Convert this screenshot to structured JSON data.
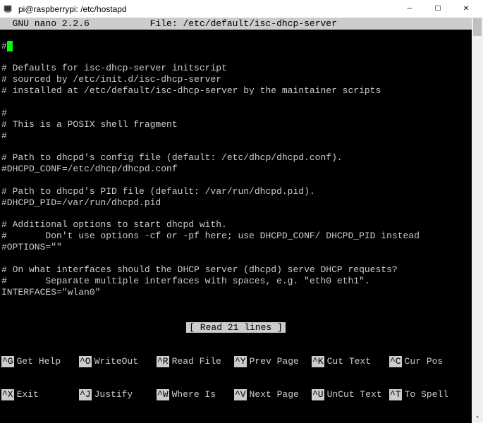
{
  "window": {
    "title": "pi@raspberrypi: /etc/hostapd"
  },
  "editor": {
    "app": "  GNU nano 2.2.6",
    "file_label": "File: /etc/default/isc-dhcp-server"
  },
  "lines": [
    " ",
    " Defaults for isc-dhcp-server initscript",
    "# sourced by /etc/init.d/isc-dhcp-server",
    "# installed at /etc/default/isc-dhcp-server by the maintainer scripts",
    "",
    "#",
    "# This is a POSIX shell fragment",
    "#",
    "",
    "# Path to dhcpd's config file (default: /etc/dhcp/dhcpd.conf).",
    "#DHCPD_CONF=/etc/dhcp/dhcpd.conf",
    "",
    "# Path to dhcpd's PID file (default: /var/run/dhcpd.pid).",
    "#DHCPD_PID=/var/run/dhcpd.pid",
    "",
    "# Additional options to start dhcpd with.",
    "#       Don't use options -cf or -pf here; use DHCPD_CONF/ DHCPD_PID instead",
    "#OPTIONS=\"\"",
    "",
    "# On what interfaces should the DHCP server (dhcpd) serve DHCP requests?",
    "#       Separate multiple interfaces with spaces, e.g. \"eth0 eth1\".",
    "INTERFACES=\"wlan0\""
  ],
  "status": "[ Read 21 lines ]",
  "shortcuts_row1": [
    {
      "key": "^G",
      "label": "Get Help"
    },
    {
      "key": "^O",
      "label": "WriteOut"
    },
    {
      "key": "^R",
      "label": "Read File"
    },
    {
      "key": "^Y",
      "label": "Prev Page"
    },
    {
      "key": "^K",
      "label": "Cut Text"
    },
    {
      "key": "^C",
      "label": "Cur Pos"
    }
  ],
  "shortcuts_row2": [
    {
      "key": "^X",
      "label": "Exit"
    },
    {
      "key": "^J",
      "label": "Justify"
    },
    {
      "key": "^W",
      "label": "Where Is"
    },
    {
      "key": "^V",
      "label": "Next Page"
    },
    {
      "key": "^U",
      "label": "UnCut Text"
    },
    {
      "key": "^T",
      "label": "To Spell"
    }
  ]
}
